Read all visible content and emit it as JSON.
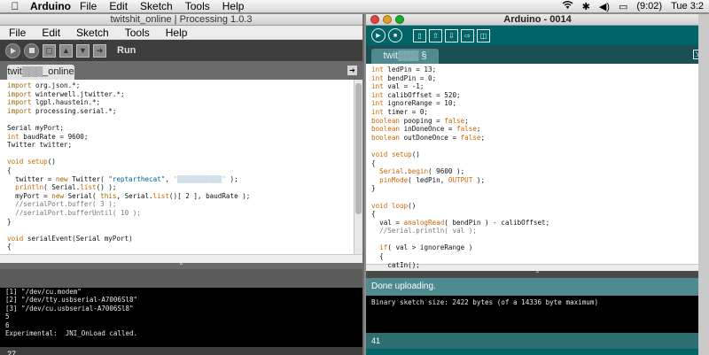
{
  "menubar": {
    "app": "Arduino",
    "items": [
      "File",
      "Edit",
      "Sketch",
      "Tools",
      "Help"
    ],
    "time": "Tue 3:2",
    "battery": "(9:02)"
  },
  "processing": {
    "title": "twitshit_online | Processing 1.0.3",
    "menu": [
      "File",
      "Edit",
      "Sketch",
      "Tools",
      "Help"
    ],
    "run_label": "Run",
    "tab": "twit▒▒▒_online",
    "tab_arrow": "➔",
    "split_glyph": "⌃",
    "line_count": "27",
    "console": [
      "[1] \"/dev/cu.modem\"",
      "[2] \"/dev/tty.usbserial-A7006Sl8\"",
      "[3] \"/dev/cu.usbserial-A7006Sl8\"",
      "5",
      "6",
      "Experimental:  JNI_OnLoad called."
    ]
  },
  "arduino": {
    "title": "Arduino - 0014",
    "tab": "twit▒▒▒ §",
    "split_glyph": "⌃",
    "status": "Done uploading.",
    "console": "Binary sketch size: 2422 bytes (of a 14336 byte maximum)",
    "line_count": "41"
  },
  "colors": {
    "arduino_teal": "#006468",
    "processing_toolbar": "#3d3d3d",
    "keyword": "#cc6600",
    "comment": "#777777"
  }
}
